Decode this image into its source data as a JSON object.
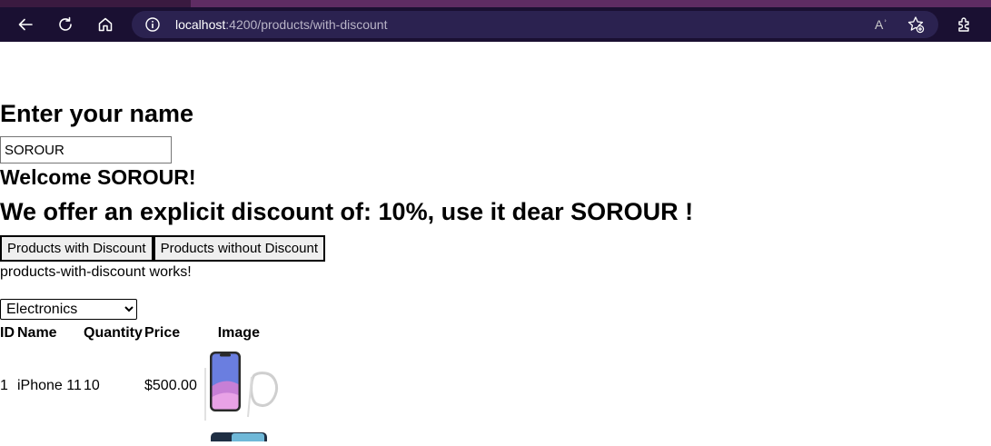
{
  "browser": {
    "url_host": "localhost",
    "url_rest": ":4200/products/with-discount",
    "icons": [
      "back-icon",
      "refresh-icon",
      "home-icon",
      "info-icon",
      "read-aloud-icon",
      "add-favorite-icon",
      "extensions-icon"
    ],
    "read_aloud_label": "Aʾ",
    "colors": {
      "tabstrip": "#5e2c63",
      "toolbar": "#1a1032",
      "address_bar": "#2b2250"
    }
  },
  "page": {
    "enter_name_heading": "Enter your name",
    "name_value": "SOROUR",
    "welcome": "Welcome SOROUR!",
    "offer": "We offer an explicit discount of: 10%, use it dear SOROUR !",
    "buttons": {
      "with_discount": "Products with Discount",
      "without_discount": "Products without Discount"
    },
    "works_text": "products-with-discount works!",
    "category_select": {
      "selected": "Electronics"
    },
    "table": {
      "headers": [
        "ID",
        "Name",
        "Quantity",
        "Price",
        "Image"
      ],
      "rows": [
        {
          "id": "1",
          "name": "iPhone 11",
          "quantity": "10",
          "price": "$500.00",
          "image": "iphone-11-image"
        }
      ]
    }
  }
}
